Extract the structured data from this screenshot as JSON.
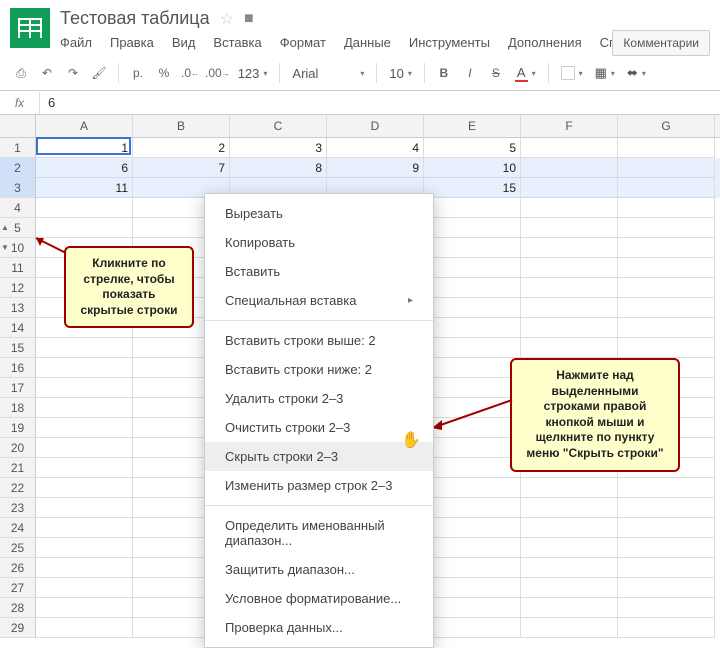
{
  "header": {
    "title": "Тестовая таблица",
    "star": "☆",
    "folder": "■",
    "menus": [
      "Файл",
      "Правка",
      "Вид",
      "Вставка",
      "Формат",
      "Данные",
      "Инструменты",
      "Дополнения",
      "Справка"
    ],
    "comments_btn": "Комментарии"
  },
  "toolbar": {
    "currency": "р.",
    "percent": "%",
    "dec_dec": ".0",
    "dec_inc": ".00",
    "formats": "123",
    "font": "Arial",
    "size": "10",
    "bold": "B",
    "italic": "I",
    "strike": "S",
    "textcolor": "A"
  },
  "formula": {
    "label": "fx",
    "value": "6"
  },
  "columns": [
    "A",
    "B",
    "C",
    "D",
    "E",
    "F",
    "G"
  ],
  "rows": [
    {
      "n": "1",
      "cells": [
        "1",
        "2",
        "3",
        "4",
        "5",
        "",
        ""
      ]
    },
    {
      "n": "2",
      "cells": [
        "6",
        "7",
        "8",
        "9",
        "10",
        "",
        ""
      ],
      "sel": true,
      "active": true
    },
    {
      "n": "3",
      "cells": [
        "11",
        "",
        "",
        "",
        "15",
        "",
        ""
      ],
      "sel": true
    },
    {
      "n": "4",
      "cells": [
        "",
        "",
        "",
        "",
        "",
        "",
        ""
      ]
    },
    {
      "n": "5",
      "cells": [
        "",
        "",
        "",
        "",
        "",
        "",
        ""
      ],
      "arrow": "▲"
    },
    {
      "n": "10",
      "cells": [
        "",
        "",
        "",
        "",
        "",
        "",
        ""
      ],
      "arrow": "▼"
    },
    {
      "n": "11",
      "cells": [
        "",
        "",
        "",
        "",
        "",
        "",
        ""
      ]
    },
    {
      "n": "12",
      "cells": [
        "",
        "",
        "",
        "",
        "",
        "",
        ""
      ]
    },
    {
      "n": "13",
      "cells": [
        "",
        "",
        "",
        "",
        "",
        "",
        ""
      ]
    },
    {
      "n": "14",
      "cells": [
        "",
        "",
        "",
        "",
        "",
        "",
        ""
      ]
    },
    {
      "n": "15",
      "cells": [
        "",
        "",
        "",
        "",
        "",
        "",
        ""
      ]
    },
    {
      "n": "16",
      "cells": [
        "",
        "",
        "",
        "",
        "",
        "",
        ""
      ]
    },
    {
      "n": "17",
      "cells": [
        "",
        "",
        "",
        "",
        "",
        "",
        ""
      ]
    },
    {
      "n": "18",
      "cells": [
        "",
        "",
        "",
        "",
        "",
        "",
        ""
      ]
    },
    {
      "n": "19",
      "cells": [
        "",
        "",
        "",
        "",
        "",
        "",
        ""
      ]
    },
    {
      "n": "20",
      "cells": [
        "",
        "",
        "",
        "",
        "",
        "",
        ""
      ]
    },
    {
      "n": "21",
      "cells": [
        "",
        "",
        "",
        "",
        "",
        "",
        ""
      ]
    },
    {
      "n": "22",
      "cells": [
        "",
        "",
        "",
        "",
        "",
        "",
        ""
      ]
    },
    {
      "n": "23",
      "cells": [
        "",
        "",
        "",
        "",
        "",
        "",
        ""
      ]
    },
    {
      "n": "24",
      "cells": [
        "",
        "",
        "",
        "",
        "",
        "",
        ""
      ]
    },
    {
      "n": "25",
      "cells": [
        "",
        "",
        "",
        "",
        "",
        "",
        ""
      ]
    },
    {
      "n": "26",
      "cells": [
        "",
        "",
        "",
        "",
        "",
        "",
        ""
      ]
    },
    {
      "n": "27",
      "cells": [
        "",
        "",
        "",
        "",
        "",
        "",
        ""
      ]
    },
    {
      "n": "28",
      "cells": [
        "",
        "",
        "",
        "",
        "",
        "",
        ""
      ]
    },
    {
      "n": "29",
      "cells": [
        "",
        "",
        "",
        "",
        "",
        "",
        ""
      ]
    }
  ],
  "context_menu": {
    "groups": [
      [
        {
          "label": "Вырезать"
        },
        {
          "label": "Копировать"
        },
        {
          "label": "Вставить"
        },
        {
          "label": "Специальная вставка",
          "sub": "▸"
        }
      ],
      [
        {
          "label": "Вставить строки выше: 2"
        },
        {
          "label": "Вставить строки ниже: 2"
        },
        {
          "label": "Удалить строки 2–3"
        },
        {
          "label": "Очистить строки 2–3"
        },
        {
          "label": "Скрыть строки 2–3",
          "hover": true
        },
        {
          "label": "Изменить размер строк 2–3"
        }
      ],
      [
        {
          "label": "Определить именованный диапазон..."
        },
        {
          "label": "Защитить диапазон..."
        },
        {
          "label": "Условное форматирование..."
        },
        {
          "label": "Проверка данных..."
        }
      ]
    ]
  },
  "callouts": {
    "a": "Кликните по стрелке, чтобы показать скрытые строки",
    "b": "Нажмите над выделенными строками правой кнопкой мыши и щелкните по пункту меню \"Скрыть строки\""
  }
}
